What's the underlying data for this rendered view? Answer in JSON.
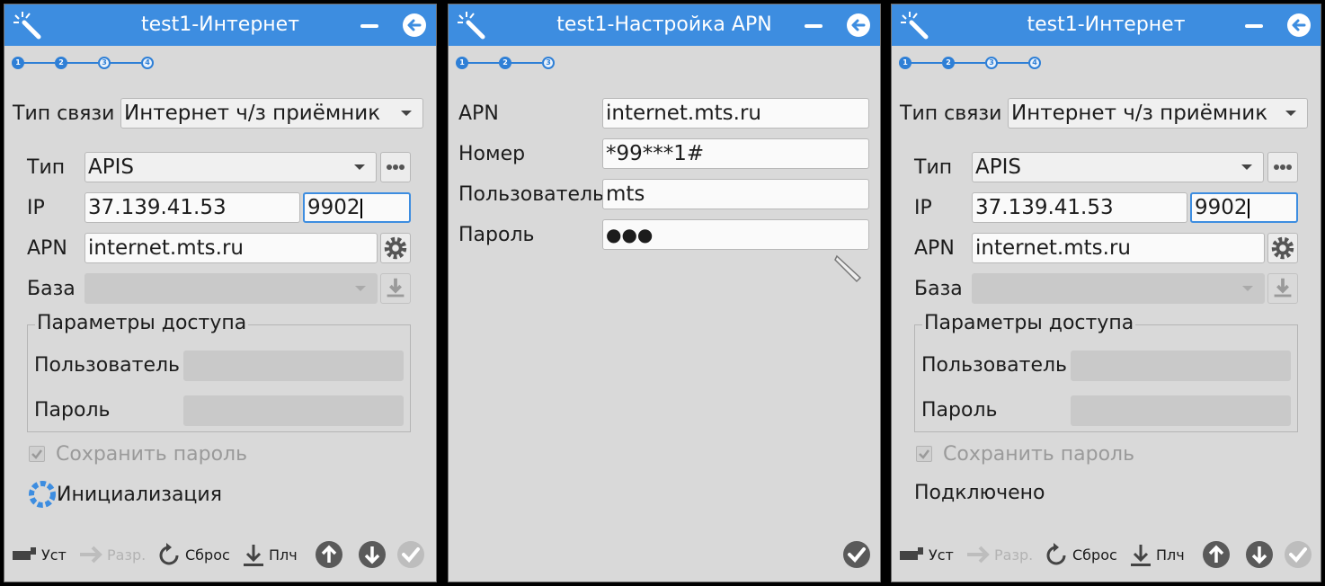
{
  "panels": [
    {
      "title": "test1-Интернет",
      "steps": [
        "1",
        "2",
        "3",
        "4"
      ],
      "conn_type_label": "Тип связи",
      "conn_type_value": "Интернет ч/з приёмник",
      "type_label": "Тип",
      "type_value": "APIS",
      "ip_label": "IP",
      "ip_value": "37.139.41.53",
      "port_value": "9902",
      "apn_label": "APN",
      "apn_value": "internet.mts.ru",
      "base_label": "База",
      "access_legend": "Параметры доступа",
      "user_label": "Пользователь",
      "pass_label": "Пароль",
      "save_pass_label": "Сохранить пароль",
      "status": "Инициализация",
      "toolbar": {
        "install": "Уст",
        "disconnect": "Разр.",
        "reset": "Сброс",
        "download": "Плч"
      }
    },
    {
      "title": "test1-Настройка APN",
      "steps": [
        "1",
        "2",
        "3"
      ],
      "apn_label": "APN",
      "apn_value": "internet.mts.ru",
      "number_label": "Номер",
      "number_value": "*99***1#",
      "user_label": "Пользователь",
      "user_value": "mts",
      "pass_label": "Пароль",
      "pass_value": "●●●"
    },
    {
      "title": "test1-Интернет",
      "steps": [
        "1",
        "2",
        "3",
        "4"
      ],
      "conn_type_label": "Тип связи",
      "conn_type_value": "Интернет ч/з приёмник",
      "type_label": "Тип",
      "type_value": "APIS",
      "ip_label": "IP",
      "ip_value": "37.139.41.53",
      "port_value": "9902",
      "apn_label": "APN",
      "apn_value": "internet.mts.ru",
      "base_label": "База",
      "access_legend": "Параметры доступа",
      "user_label": "Пользователь",
      "pass_label": "Пароль",
      "save_pass_label": "Сохранить пароль",
      "status": "Подключено",
      "toolbar": {
        "install": "Уст",
        "disconnect": "Разр.",
        "reset": "Сброс",
        "download": "Плч"
      }
    }
  ],
  "colors": {
    "titlebar": "#3d8de0",
    "window_bg": "#d9d9d9",
    "step": "#2e7fd6"
  }
}
